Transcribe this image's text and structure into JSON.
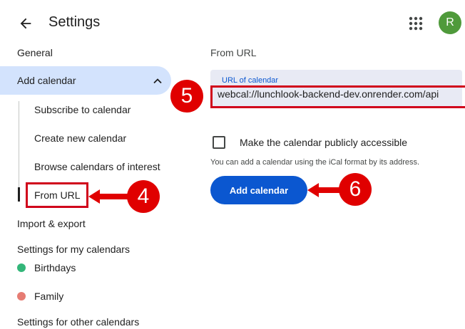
{
  "header": {
    "title": "Settings",
    "avatar_initial": "R"
  },
  "sidebar": {
    "general": "General",
    "add_calendar": "Add calendar",
    "sub_items": [
      "Subscribe to calendar",
      "Create new calendar",
      "Browse calendars of interest",
      "From URL"
    ],
    "import_export": "Import & export",
    "my_calendars_heading": "Settings for my calendars",
    "my_calendars": [
      {
        "label": "Birthdays",
        "color": "#33b679"
      },
      {
        "label": "Family",
        "color": "#e67c73"
      }
    ],
    "other_calendars_heading": "Settings for other calendars"
  },
  "main": {
    "section_title": "From URL",
    "url_label": "URL of calendar",
    "url_value": "webcal://lunchlook-backend-dev.onrender.com/api",
    "checkbox_label": "Make the calendar publicly accessible",
    "checkbox_checked": false,
    "helper_text": "You can add a calendar using the iCal format by its address.",
    "add_button": "Add calendar"
  },
  "callouts": {
    "four": "4",
    "five": "5",
    "six": "6",
    "color": "#e00000"
  },
  "colors": {
    "accent": "#0b57d0",
    "active_nav_bg": "#d3e3fd",
    "avatar_bg": "#4f9a3b"
  },
  "icons": {
    "back": "arrow-back-icon",
    "apps": "apps-grid-icon",
    "chevron": "chevron-up-icon"
  }
}
